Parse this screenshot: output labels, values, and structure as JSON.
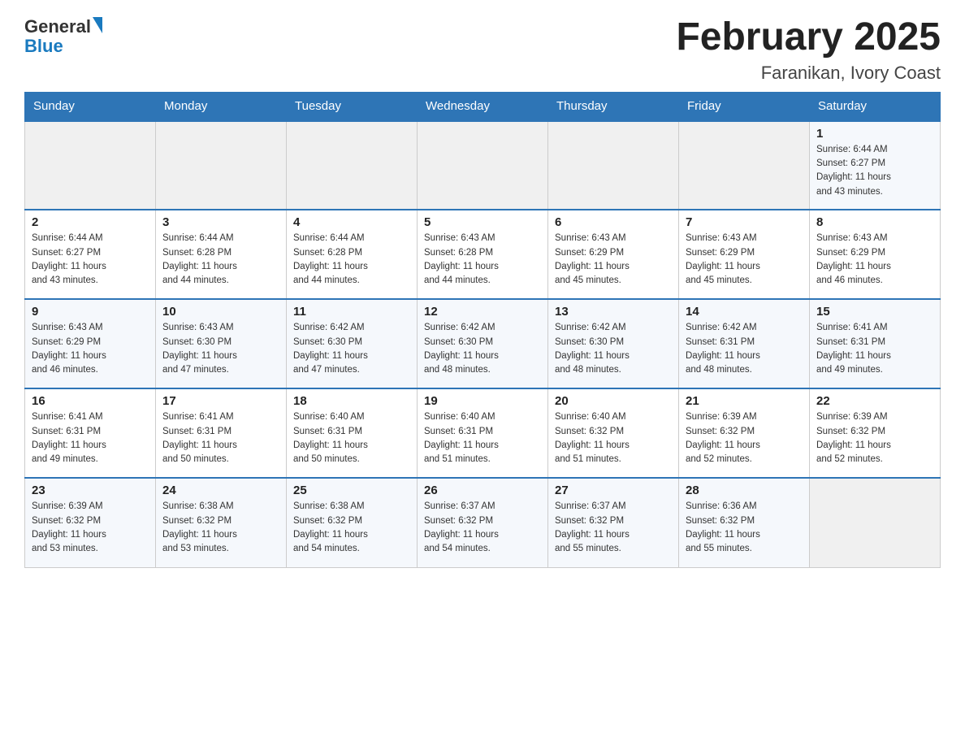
{
  "header": {
    "logo_general": "General",
    "logo_blue": "Blue",
    "month_title": "February 2025",
    "location": "Faranikan, Ivory Coast"
  },
  "days_of_week": [
    "Sunday",
    "Monday",
    "Tuesday",
    "Wednesday",
    "Thursday",
    "Friday",
    "Saturday"
  ],
  "weeks": [
    [
      {
        "day": "",
        "info": ""
      },
      {
        "day": "",
        "info": ""
      },
      {
        "day": "",
        "info": ""
      },
      {
        "day": "",
        "info": ""
      },
      {
        "day": "",
        "info": ""
      },
      {
        "day": "",
        "info": ""
      },
      {
        "day": "1",
        "info": "Sunrise: 6:44 AM\nSunset: 6:27 PM\nDaylight: 11 hours\nand 43 minutes."
      }
    ],
    [
      {
        "day": "2",
        "info": "Sunrise: 6:44 AM\nSunset: 6:27 PM\nDaylight: 11 hours\nand 43 minutes."
      },
      {
        "day": "3",
        "info": "Sunrise: 6:44 AM\nSunset: 6:28 PM\nDaylight: 11 hours\nand 44 minutes."
      },
      {
        "day": "4",
        "info": "Sunrise: 6:44 AM\nSunset: 6:28 PM\nDaylight: 11 hours\nand 44 minutes."
      },
      {
        "day": "5",
        "info": "Sunrise: 6:43 AM\nSunset: 6:28 PM\nDaylight: 11 hours\nand 44 minutes."
      },
      {
        "day": "6",
        "info": "Sunrise: 6:43 AM\nSunset: 6:29 PM\nDaylight: 11 hours\nand 45 minutes."
      },
      {
        "day": "7",
        "info": "Sunrise: 6:43 AM\nSunset: 6:29 PM\nDaylight: 11 hours\nand 45 minutes."
      },
      {
        "day": "8",
        "info": "Sunrise: 6:43 AM\nSunset: 6:29 PM\nDaylight: 11 hours\nand 46 minutes."
      }
    ],
    [
      {
        "day": "9",
        "info": "Sunrise: 6:43 AM\nSunset: 6:29 PM\nDaylight: 11 hours\nand 46 minutes."
      },
      {
        "day": "10",
        "info": "Sunrise: 6:43 AM\nSunset: 6:30 PM\nDaylight: 11 hours\nand 47 minutes."
      },
      {
        "day": "11",
        "info": "Sunrise: 6:42 AM\nSunset: 6:30 PM\nDaylight: 11 hours\nand 47 minutes."
      },
      {
        "day": "12",
        "info": "Sunrise: 6:42 AM\nSunset: 6:30 PM\nDaylight: 11 hours\nand 48 minutes."
      },
      {
        "day": "13",
        "info": "Sunrise: 6:42 AM\nSunset: 6:30 PM\nDaylight: 11 hours\nand 48 minutes."
      },
      {
        "day": "14",
        "info": "Sunrise: 6:42 AM\nSunset: 6:31 PM\nDaylight: 11 hours\nand 48 minutes."
      },
      {
        "day": "15",
        "info": "Sunrise: 6:41 AM\nSunset: 6:31 PM\nDaylight: 11 hours\nand 49 minutes."
      }
    ],
    [
      {
        "day": "16",
        "info": "Sunrise: 6:41 AM\nSunset: 6:31 PM\nDaylight: 11 hours\nand 49 minutes."
      },
      {
        "day": "17",
        "info": "Sunrise: 6:41 AM\nSunset: 6:31 PM\nDaylight: 11 hours\nand 50 minutes."
      },
      {
        "day": "18",
        "info": "Sunrise: 6:40 AM\nSunset: 6:31 PM\nDaylight: 11 hours\nand 50 minutes."
      },
      {
        "day": "19",
        "info": "Sunrise: 6:40 AM\nSunset: 6:31 PM\nDaylight: 11 hours\nand 51 minutes."
      },
      {
        "day": "20",
        "info": "Sunrise: 6:40 AM\nSunset: 6:32 PM\nDaylight: 11 hours\nand 51 minutes."
      },
      {
        "day": "21",
        "info": "Sunrise: 6:39 AM\nSunset: 6:32 PM\nDaylight: 11 hours\nand 52 minutes."
      },
      {
        "day": "22",
        "info": "Sunrise: 6:39 AM\nSunset: 6:32 PM\nDaylight: 11 hours\nand 52 minutes."
      }
    ],
    [
      {
        "day": "23",
        "info": "Sunrise: 6:39 AM\nSunset: 6:32 PM\nDaylight: 11 hours\nand 53 minutes."
      },
      {
        "day": "24",
        "info": "Sunrise: 6:38 AM\nSunset: 6:32 PM\nDaylight: 11 hours\nand 53 minutes."
      },
      {
        "day": "25",
        "info": "Sunrise: 6:38 AM\nSunset: 6:32 PM\nDaylight: 11 hours\nand 54 minutes."
      },
      {
        "day": "26",
        "info": "Sunrise: 6:37 AM\nSunset: 6:32 PM\nDaylight: 11 hours\nand 54 minutes."
      },
      {
        "day": "27",
        "info": "Sunrise: 6:37 AM\nSunset: 6:32 PM\nDaylight: 11 hours\nand 55 minutes."
      },
      {
        "day": "28",
        "info": "Sunrise: 6:36 AM\nSunset: 6:32 PM\nDaylight: 11 hours\nand 55 minutes."
      },
      {
        "day": "",
        "info": ""
      }
    ]
  ]
}
